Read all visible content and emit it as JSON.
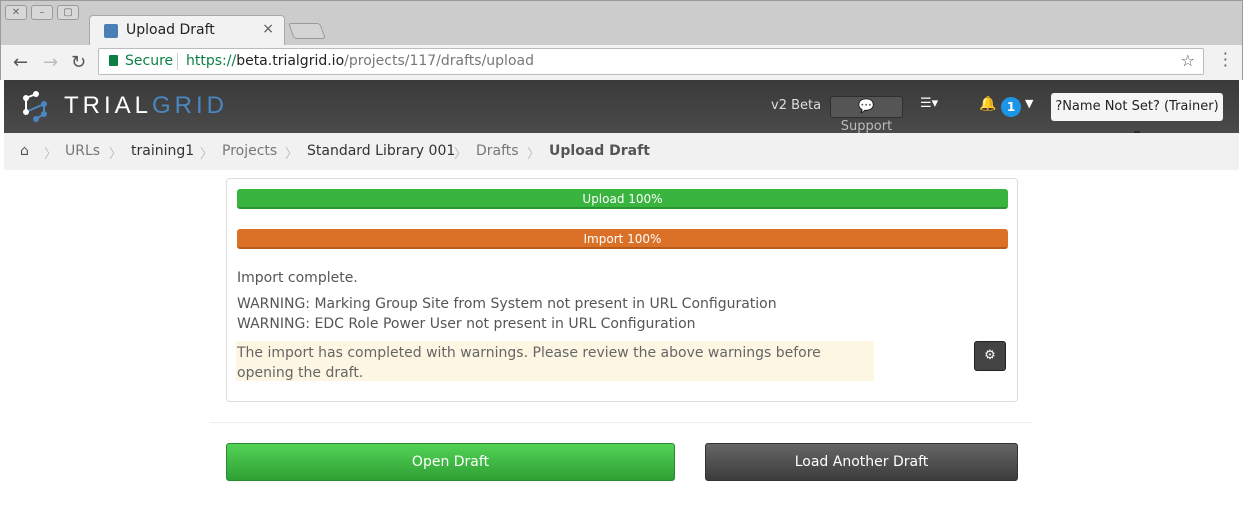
{
  "browser": {
    "window_controls": [
      "close",
      "minimize",
      "maximize"
    ],
    "tab": {
      "title": "Upload Draft",
      "close_label": "×"
    },
    "secure_label": "Secure",
    "url": {
      "scheme": "https://",
      "host": "beta.trialgrid.io",
      "path": "/projects/117/drafts/upload"
    }
  },
  "navbar": {
    "brand_part1": "TRIAL",
    "brand_part2": "GRID",
    "version": "v2 Beta",
    "support_label": "Support",
    "notification_count": "1",
    "user_menu_label": "?Name Not Set? (Trainer)"
  },
  "breadcrumb": {
    "items": [
      {
        "label": "URLs"
      },
      {
        "label": "training1"
      },
      {
        "label": "Projects"
      },
      {
        "label": "Standard Library 001"
      },
      {
        "label": "Drafts"
      },
      {
        "label": "Upload Draft"
      }
    ]
  },
  "progress": {
    "upload": {
      "label": "Upload 100%",
      "value": 100,
      "color": "#38b43f"
    },
    "import": {
      "label": "Import 100%",
      "value": 100,
      "color": "#db7127"
    }
  },
  "messages": {
    "status": "Import complete.",
    "warnings": [
      "WARNING: Marking Group Site from System not present in URL Configuration",
      "WARNING: EDC Role Power User not present in URL Configuration"
    ],
    "summary": "The import has completed with warnings. Please review the above warnings before opening the draft."
  },
  "actions": {
    "open_label": "Open Draft",
    "load_another_label": "Load Another Draft"
  }
}
